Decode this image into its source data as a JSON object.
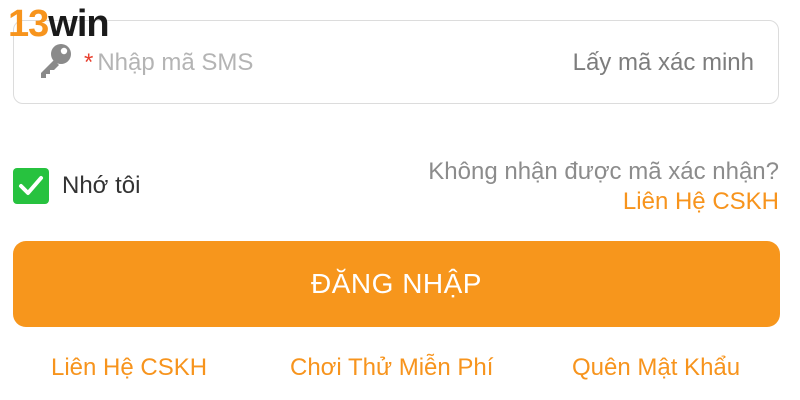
{
  "logo": {
    "number": "13",
    "word": "win"
  },
  "sms_field": {
    "required_mark": "*",
    "placeholder": "Nhập mã SMS",
    "get_code_label": "Lấy mã xác minh",
    "icon": "key-icon"
  },
  "remember": {
    "label": "Nhớ tôi",
    "checked": true
  },
  "help": {
    "question": "Không nhận được mã xác nhận?",
    "contact_link": "Liên Hệ CSKH"
  },
  "login_button": {
    "label": "ĐĂNG NHẬP"
  },
  "bottom_links": {
    "contact": "Liên Hệ CSKH",
    "free_play": "Chơi Thử Miễn Phí",
    "forgot_password": "Quên Mật Khẩu"
  },
  "colors": {
    "accent": "#f7941d",
    "check_green": "#27c23f",
    "required_red": "#e8402f"
  }
}
